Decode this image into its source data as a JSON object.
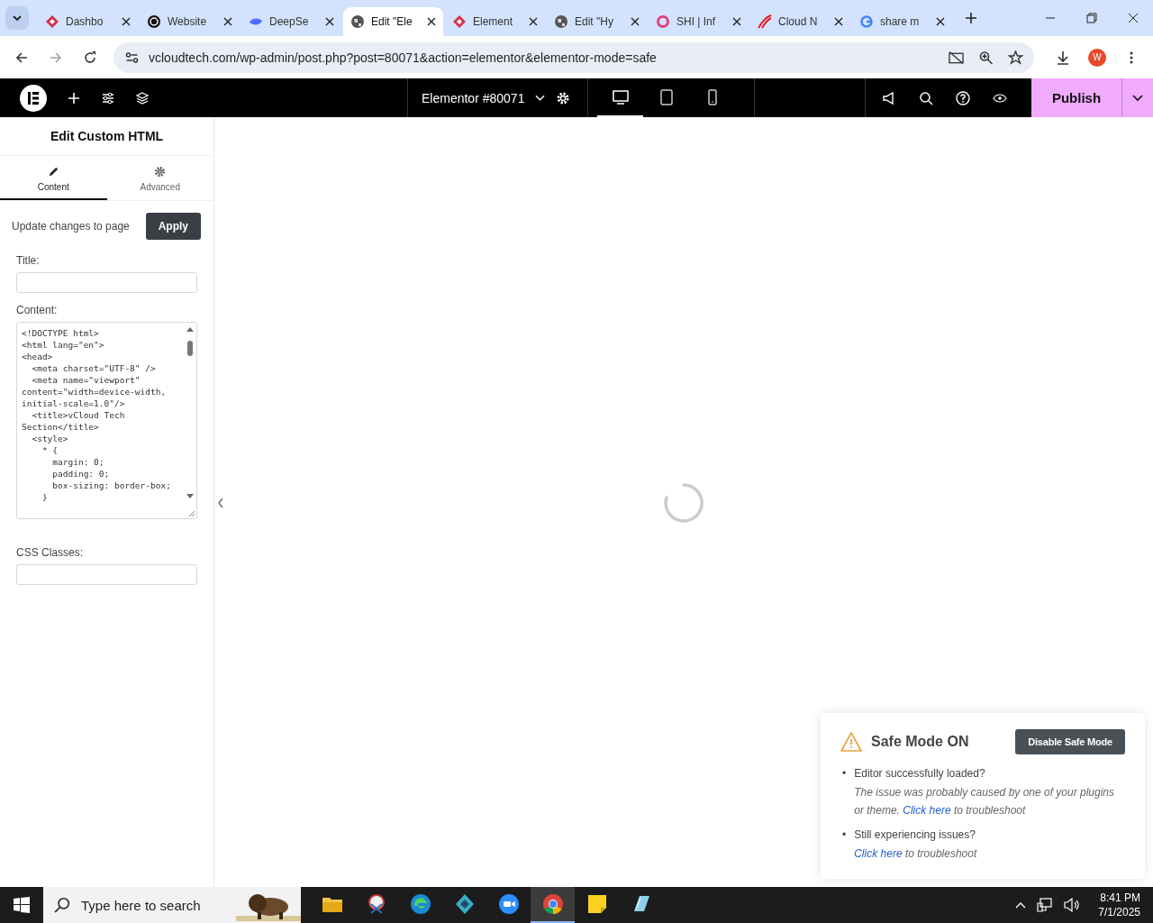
{
  "browser": {
    "tabs": [
      {
        "title": "Dashbo",
        "selected": false
      },
      {
        "title": "Website",
        "selected": false
      },
      {
        "title": "DeepSe",
        "selected": false
      },
      {
        "title": "Edit \"Ele",
        "selected": true
      },
      {
        "title": "Element",
        "selected": false
      },
      {
        "title": "Edit \"Hy",
        "selected": false
      },
      {
        "title": "SHI | Inf",
        "selected": false
      },
      {
        "title": "Cloud N",
        "selected": false
      },
      {
        "title": "share m",
        "selected": false
      }
    ],
    "url": "vcloudtech.com/wp-admin/post.php?post=80071&action=elementor&elementor-mode=safe",
    "profile": "W"
  },
  "editor_bar": {
    "document": "Elementor #80071",
    "devices": [
      {
        "kind": "desktop",
        "selected": true
      },
      {
        "kind": "tablet",
        "selected": false
      },
      {
        "kind": "mobile",
        "selected": false
      }
    ],
    "publish": "Publish"
  },
  "panel": {
    "title": "Edit Custom HTML",
    "tabs": [
      {
        "label": "Content",
        "selected": true
      },
      {
        "label": "Advanced",
        "selected": false
      }
    ],
    "update_label": "Update changes to page",
    "apply": "Apply",
    "fields": [
      {
        "label": "Title:",
        "kind": "input"
      },
      {
        "label": "Content:",
        "kind": "code",
        "lines": [
          "<!DOCTYPE html>",
          "<html lang=\"en\">",
          "<head>",
          "  <meta charset=\"UTF-8\" />",
          "  <meta name=\"viewport\"",
          "content=\"width=device-width,",
          "initial-scale=1.0\"/>",
          "  <title>vCloud Tech",
          "Section</title>",
          "  <style>",
          "    * {",
          "      margin: 0;",
          "      padding: 0;",
          "      box-sizing: border-box;",
          "    }"
        ]
      },
      {
        "label": "CSS Classes:",
        "kind": "input"
      }
    ]
  },
  "safe_mode": {
    "title": "Safe Mode ON",
    "button": "Disable Safe Mode",
    "items": [
      {
        "bullet": "•",
        "question": "Editor successfully loaded?",
        "before": "The issue was probably caused by one of your plugins or theme.",
        "link": "Click here",
        "after": "to troubleshoot"
      },
      {
        "bullet": "•",
        "question": "Still experiencing issues?",
        "link": "Click here",
        "after": "to troubleshoot"
      }
    ]
  },
  "taskbar": {
    "search_placeholder": "Type here to search",
    "apps": [
      {
        "kind": "folder",
        "selected": false
      },
      {
        "kind": "snip",
        "selected": false
      },
      {
        "kind": "edge",
        "selected": false
      },
      {
        "kind": "gem",
        "selected": false
      },
      {
        "kind": "zoom",
        "selected": false
      },
      {
        "kind": "chrome",
        "selected": true
      },
      {
        "kind": "note",
        "selected": false
      },
      {
        "kind": "pad",
        "selected": false
      }
    ],
    "time": "8:41 PM",
    "date": "7/1/2025"
  }
}
